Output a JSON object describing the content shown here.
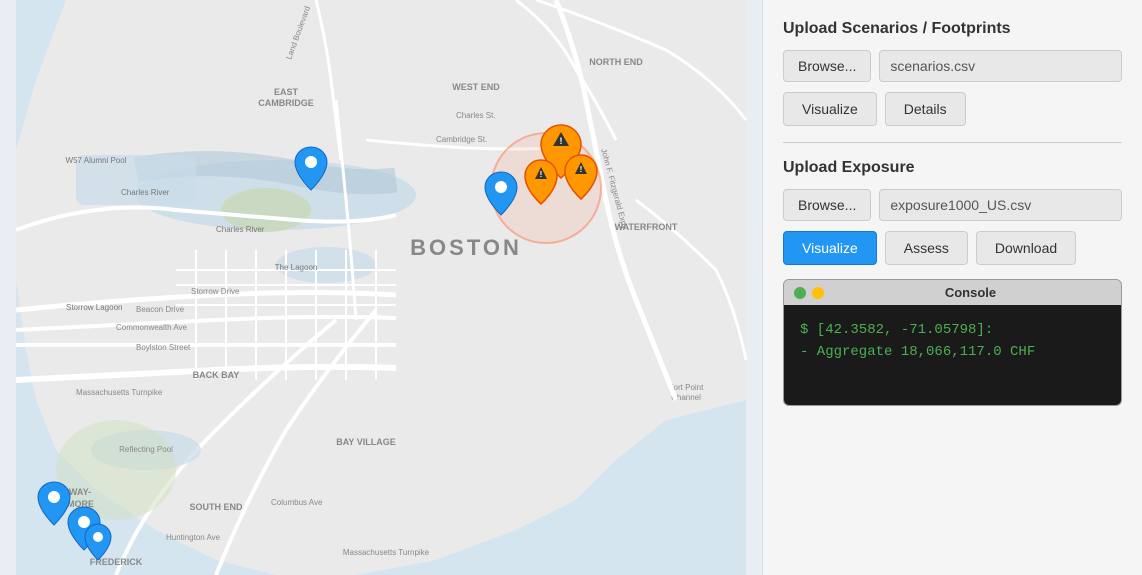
{
  "sidebar": {
    "section1_title": "Upload Scenarios / Footprints",
    "browse1_label": "Browse...",
    "file1_name": "scenarios.csv",
    "visualize1_label": "Visualize",
    "details1_label": "Details",
    "section2_title": "Upload Exposure",
    "browse2_label": "Browse...",
    "file2_name": "exposure1000_US.csv",
    "visualize2_label": "Visualize",
    "assess_label": "Assess",
    "download_label": "Download"
  },
  "console": {
    "title": "Console",
    "dot1_color": "green",
    "dot2_color": "yellow",
    "line1": "$ [42.3582, -71.05798]:",
    "line2": "- Aggregate 18,066,117.0 CHF"
  },
  "map": {
    "city_label": "BOSTON"
  }
}
